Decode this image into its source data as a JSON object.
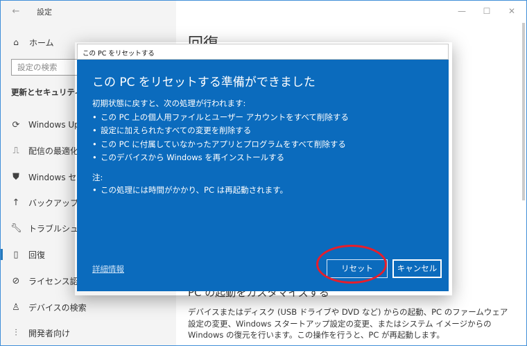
{
  "window": {
    "back_icon": "arrow-left-icon",
    "title": "設定",
    "controls": [
      "—",
      "☐",
      "✕"
    ]
  },
  "sidebar": {
    "home_label": "ホーム",
    "search_placeholder": "設定の検索",
    "section_title": "更新とセキュリティ",
    "items": [
      {
        "label": "Windows Update",
        "icon": "sync-icon"
      },
      {
        "label": "配信の最適化",
        "icon": "delivery-optimization-icon"
      },
      {
        "label": "Windows セキュリティ",
        "icon": "shield-icon"
      },
      {
        "label": "バックアップ",
        "icon": "backup-arrow-icon"
      },
      {
        "label": "トラブルシューティング",
        "icon": "wrench-icon"
      },
      {
        "label": "回復",
        "icon": "recovery-icon",
        "selected": true
      },
      {
        "label": "ライセンス認証",
        "icon": "check-circle-icon"
      },
      {
        "label": "デバイスの検索",
        "icon": "person-location-icon"
      },
      {
        "label": "開発者向け",
        "icon": "developer-icon"
      }
    ]
  },
  "content": {
    "title": "回復",
    "heading": "PC の起動をカスタマイズする",
    "body": "デバイスまたはディスク (USB ドライブや DVD など) からの起動、PC のファームウェア設定の変更、Windows スタートアップ設定の変更、またはシステム イメージからの Windows の復元を行います。この操作を行うと、PC が再起動します。"
  },
  "dialog": {
    "window_title": "この PC をリセットする",
    "heading": "この PC をリセットする準備ができました",
    "intro": "初期状態に戻すと、次の処理が行われます:",
    "bullets": [
      "この PC 上の個人用ファイルとユーザー アカウントをすべて削除する",
      "設定に加えられたすべての変更を削除する",
      "この PC に付属していなかったアプリとプログラムをすべて削除する",
      "このデバイスから Windows を再インストールする"
    ],
    "note_label": "注:",
    "notes": [
      "この処理には時間がかかり、PC は再起動されます。"
    ],
    "more_info_link": "詳細情報",
    "reset_button": "リセット",
    "cancel_button": "キャンセル"
  },
  "colors": {
    "dialog_background": "#0b6bbd",
    "highlight_circle": "#e61e2b",
    "accent": "#0063b1"
  }
}
